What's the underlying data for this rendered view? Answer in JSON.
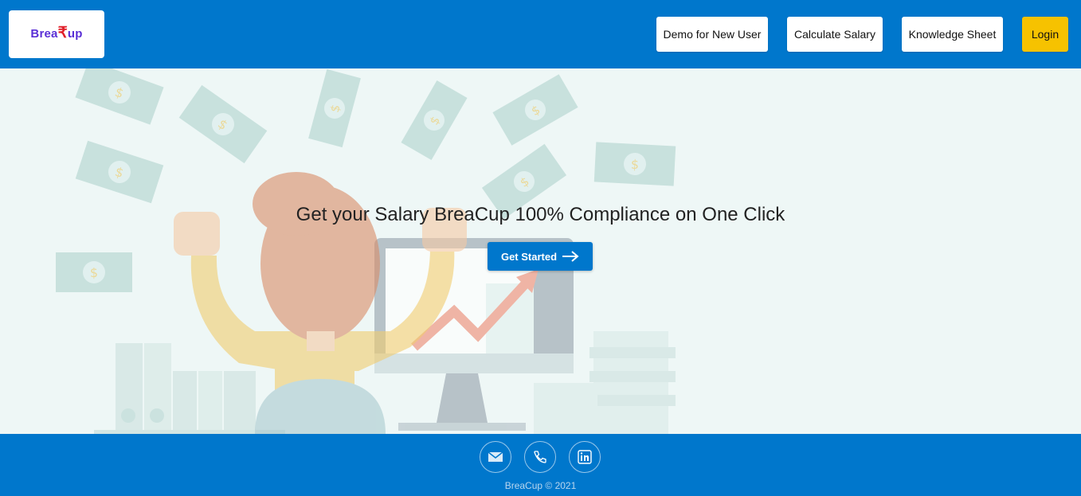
{
  "brand": {
    "logo_text_before": "Brea",
    "logo_rupee": "₹",
    "logo_text_after": "up",
    "logo_alt": "BreaCup"
  },
  "nav": {
    "demo_label": "Demo for New User",
    "calculate_label": "Calculate Salary",
    "knowledge_label": "Knowledge Sheet",
    "login_label": "Login"
  },
  "hero": {
    "headline": "Get your Salary BreaCup 100% Compliance on One Click",
    "cta_label": "Get Started",
    "cta_icon": "arrow-right-icon"
  },
  "footer": {
    "icons": [
      "mail-icon",
      "phone-icon",
      "linkedin-icon"
    ],
    "copyright": "BreaCup © 2021"
  },
  "colors": {
    "primary": "#0077cc",
    "login": "#f6c200",
    "hero_bg": "#eef7f6"
  }
}
